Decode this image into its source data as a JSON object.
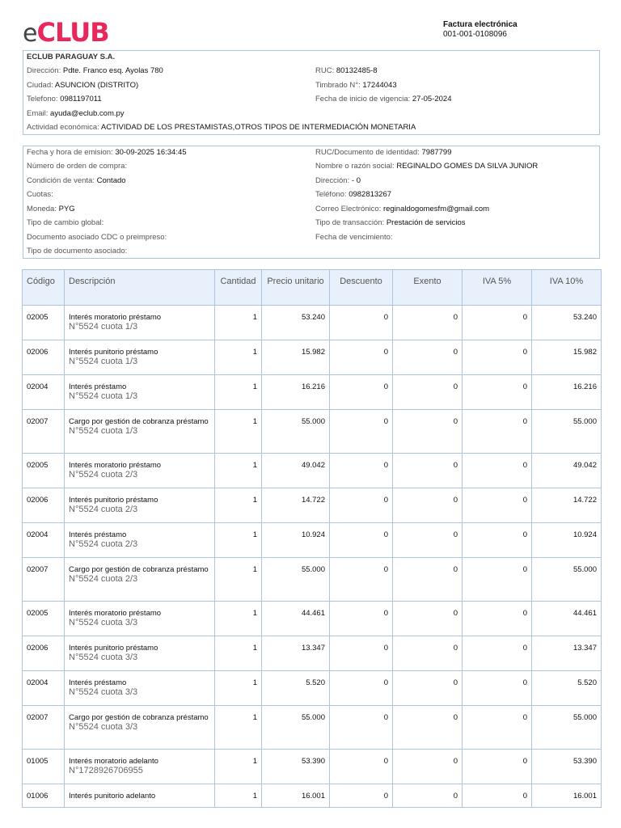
{
  "logo": {
    "prefix": "e",
    "main": "CLUB"
  },
  "invoice": {
    "title": "Factura electrónica",
    "number": "001-001-0108096"
  },
  "issuer": {
    "name": "ECLUB PARAGUAY S.A.",
    "address_label": "Dirección:",
    "address": "Pdte. Franco esq. Ayolas 780",
    "city_label": "Ciudad:",
    "city": "ASUNCION (DISTRITO)",
    "phone_label": "Telefono:",
    "phone": "0981197011",
    "email_label": "Email:",
    "email": "ayuda@eclub.com.py",
    "activity_label": "Actividad económica:",
    "activity": "ACTIVIDAD DE LOS PRESTAMISTAS,OTROS TIPOS DE INTERMEDIACIÓN MONETARIA",
    "ruc_label": "RUC:",
    "ruc": "80132485-8",
    "timbrado_label": "Timbrado N°:",
    "timbrado": "17244043",
    "validity_label": "Fecha de inicio de vigencia:",
    "validity": "27-05-2024"
  },
  "customer": {
    "emission_label": "Fecha y hora de emision:",
    "emission": "30-09-2025 16:34:45",
    "order_label": "Número de orden de compra:",
    "order": "",
    "condition_label": "Condición de venta:",
    "condition": "Contado",
    "installments_label": "Cuotas:",
    "installments": "",
    "currency_label": "Moneda:",
    "currency": "PYG",
    "exchange_label": "Tipo de cambio global:",
    "exchange": "",
    "associated_doc_label": "Documento asociado CDC o preimpreso:",
    "associated_doc": "",
    "doc_type_label": "Tipo de documento asociado:",
    "doc_type": "",
    "id_label": "RUC/Documento de identidad:",
    "id": "7987799",
    "name_label": "Nombre o razón social:",
    "name": "REGINALDO GOMES DA SILVA JUNIOR",
    "address_label": "Dirección:",
    "address": "- 0",
    "phone_label": "Teléfono:",
    "phone": "0982813267",
    "email_label": "Correo Electrónico:",
    "email": "reginaldogomesfm@gmail.com",
    "transaction_label": "Tipo de transacción:",
    "transaction": "Prestación de servicios",
    "due_label": "Fecha de vencimiento:",
    "due": ""
  },
  "table": {
    "headers": [
      "Código",
      "Descripción",
      "Cantidad",
      "Precio unitario",
      "Descuento",
      "Exento",
      "IVA 5%",
      "IVA 10%"
    ],
    "rows": [
      {
        "code": "02005",
        "desc": "Interés moratorio préstamo",
        "sub": "N°5524 cuota 1/3",
        "qty": "1",
        "price": "53.240",
        "discount": "0",
        "exempt": "0",
        "iva5": "0",
        "iva10": "53.240"
      },
      {
        "code": "02006",
        "desc": "Interés punitorio préstamo",
        "sub": "N°5524 cuota 1/3",
        "qty": "1",
        "price": "15.982",
        "discount": "0",
        "exempt": "0",
        "iva5": "0",
        "iva10": "15.982"
      },
      {
        "code": "02004",
        "desc": "Interés préstamo",
        "sub": "N°5524 cuota 1/3",
        "qty": "1",
        "price": "16.216",
        "discount": "0",
        "exempt": "0",
        "iva5": "0",
        "iva10": "16.216"
      },
      {
        "code": "02007",
        "desc": "Cargo por gestión de cobranza préstamo",
        "sub": "N°5524 cuota 1/3",
        "qty": "1",
        "price": "55.000",
        "discount": "0",
        "exempt": "0",
        "iva5": "0",
        "iva10": "55.000"
      },
      {
        "code": "02005",
        "desc": "Interés moratorio préstamo",
        "sub": "N°5524 cuota 2/3",
        "qty": "1",
        "price": "49.042",
        "discount": "0",
        "exempt": "0",
        "iva5": "0",
        "iva10": "49.042"
      },
      {
        "code": "02006",
        "desc": "Interés punitorio préstamo",
        "sub": "N°5524 cuota 2/3",
        "qty": "1",
        "price": "14.722",
        "discount": "0",
        "exempt": "0",
        "iva5": "0",
        "iva10": "14.722"
      },
      {
        "code": "02004",
        "desc": "Interés préstamo",
        "sub": "N°5524 cuota 2/3",
        "qty": "1",
        "price": "10.924",
        "discount": "0",
        "exempt": "0",
        "iva5": "0",
        "iva10": "10.924"
      },
      {
        "code": "02007",
        "desc": "Cargo por gestión de cobranza préstamo",
        "sub": "N°5524 cuota 2/3",
        "qty": "1",
        "price": "55.000",
        "discount": "0",
        "exempt": "0",
        "iva5": "0",
        "iva10": "55.000"
      },
      {
        "code": "02005",
        "desc": "Interés moratorio préstamo",
        "sub": "N°5524 cuota 3/3",
        "qty": "1",
        "price": "44.461",
        "discount": "0",
        "exempt": "0",
        "iva5": "0",
        "iva10": "44.461"
      },
      {
        "code": "02006",
        "desc": "Interés punitorio préstamo",
        "sub": "N°5524 cuota 3/3",
        "qty": "1",
        "price": "13.347",
        "discount": "0",
        "exempt": "0",
        "iva5": "0",
        "iva10": "13.347"
      },
      {
        "code": "02004",
        "desc": "Interés préstamo",
        "sub": "N°5524 cuota 3/3",
        "qty": "1",
        "price": "5.520",
        "discount": "0",
        "exempt": "0",
        "iva5": "0",
        "iva10": "5.520"
      },
      {
        "code": "02007",
        "desc": "Cargo por gestión de cobranza préstamo",
        "sub": "N°5524 cuota 3/3",
        "qty": "1",
        "price": "55.000",
        "discount": "0",
        "exempt": "0",
        "iva5": "0",
        "iva10": "55.000"
      },
      {
        "code": "01005",
        "desc": "Interés moratorio adelanto",
        "sub": "N°1728926706955",
        "qty": "1",
        "price": "53.390",
        "discount": "0",
        "exempt": "0",
        "iva5": "0",
        "iva10": "53.390"
      },
      {
        "code": "01006",
        "desc": "Interés punitorio adelanto",
        "sub": "",
        "qty": "1",
        "price": "16.001",
        "discount": "0",
        "exempt": "0",
        "iva5": "0",
        "iva10": "16.001"
      }
    ]
  }
}
